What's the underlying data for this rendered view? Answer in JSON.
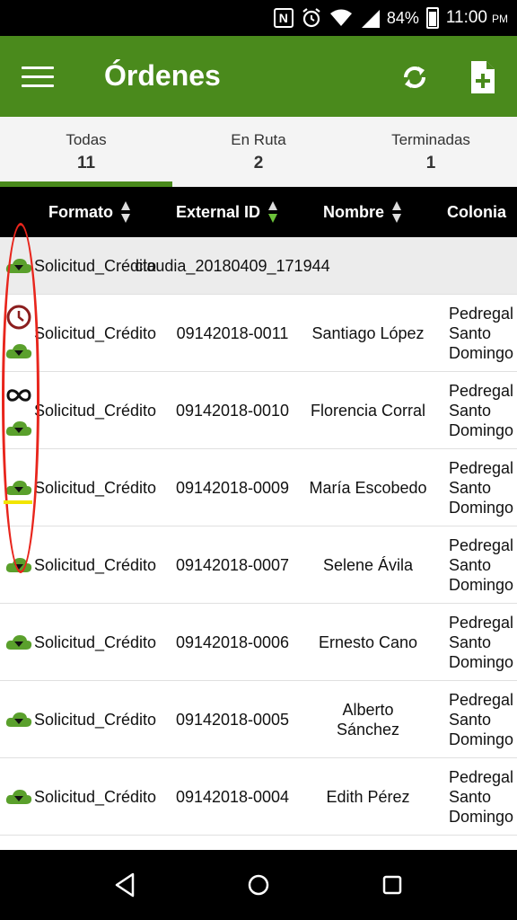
{
  "status_bar": {
    "nfc": "N",
    "battery": "84%",
    "time": "11:00",
    "ampm": "PM",
    "icons": [
      "nfc-icon",
      "alarm-icon",
      "wifi-icon",
      "signal-icon",
      "battery-icon"
    ]
  },
  "appbar": {
    "title": "Órdenes",
    "color": "#4a8a1c",
    "icons": [
      "menu-icon",
      "refresh-icon",
      "new-document-icon"
    ]
  },
  "tabs": [
    {
      "label": "Todas",
      "count": "11"
    },
    {
      "label": "En Ruta",
      "count": "2"
    },
    {
      "label": "Terminadas",
      "count": "1"
    }
  ],
  "table": {
    "columns": [
      "Formato",
      "External ID",
      "Nombre",
      "Colonia"
    ],
    "rows": [
      {
        "icons": [
          "cloud-download-icon"
        ],
        "formato": "Solicitud_Crédito",
        "external_id": "claudia_20180409_171944",
        "nombre": "",
        "colonia": ""
      },
      {
        "icons": [
          "clock-icon",
          "cloud-download-icon"
        ],
        "formato": "Solicitud_Crédito",
        "external_id": "09142018-0011",
        "nombre": "Santiago López",
        "colonia": "Pedregal de Santo Domingo"
      },
      {
        "icons": [
          "infinity-icon",
          "cloud-download-icon"
        ],
        "formato": "Solicitud_Crédito",
        "external_id": "09142018-0010",
        "nombre": "Florencia Corral",
        "colonia": "Pedregal de Santo Domingo"
      },
      {
        "icons": [
          "cloud-download-icon"
        ],
        "formato": "Solicitud_Crédito",
        "external_id": "09142018-0009",
        "nombre": "María Escobedo",
        "colonia": "Pedregal de Santo Domingo"
      },
      {
        "icons": [
          "cloud-download-icon"
        ],
        "formato": "Solicitud_Crédito",
        "external_id": "09142018-0007",
        "nombre": "Selene Ávila",
        "colonia": "Pedregal de Santo Domingo"
      },
      {
        "icons": [
          "cloud-download-icon"
        ],
        "formato": "Solicitud_Crédito",
        "external_id": "09142018-0006",
        "nombre": "Ernesto Cano",
        "colonia": "Pedregal de Santo Domingo"
      },
      {
        "icons": [
          "cloud-download-icon"
        ],
        "formato": "Solicitud_Crédito",
        "external_id": "09142018-0005",
        "nombre": "Alberto Sánchez",
        "colonia": "Pedregal de Santo Domingo"
      },
      {
        "icons": [
          "cloud-download-icon"
        ],
        "formato": "Solicitud_Crédito",
        "external_id": "09142018-0004",
        "nombre": "Edith Pérez",
        "colonia": "Pedregal de Santo Domingo"
      }
    ]
  },
  "navbar": {
    "icons": [
      "back-icon",
      "home-icon",
      "recents-icon"
    ]
  }
}
